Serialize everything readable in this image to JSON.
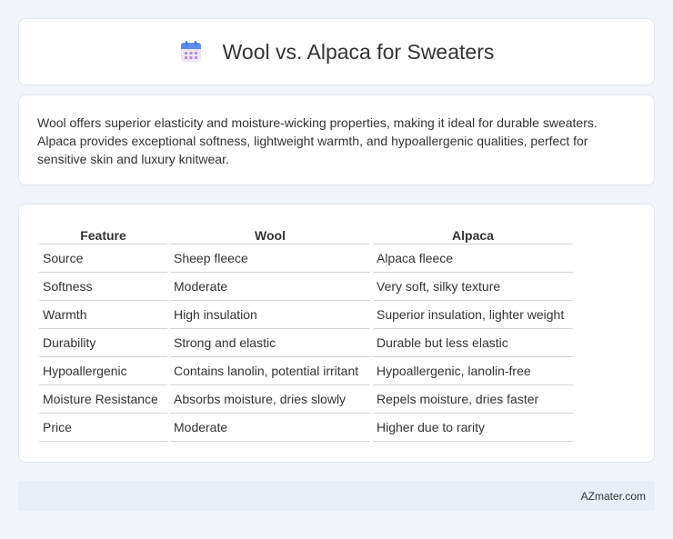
{
  "header": {
    "title": "Wool vs. Alpaca for Sweaters",
    "icon": "calendar-icon"
  },
  "description": "Wool offers superior elasticity and moisture-wicking properties, making it ideal for durable sweaters. Alpaca provides exceptional softness, lightweight warmth, and hypoallergenic qualities, perfect for sensitive skin and luxury knitwear.",
  "table": {
    "headers": [
      "Feature",
      "Wool",
      "Alpaca"
    ],
    "rows": [
      [
        "Source",
        "Sheep fleece",
        "Alpaca fleece"
      ],
      [
        "Softness",
        "Moderate",
        "Very soft, silky texture"
      ],
      [
        "Warmth",
        "High insulation",
        "Superior insulation, lighter weight"
      ],
      [
        "Durability",
        "Strong and elastic",
        "Durable but less elastic"
      ],
      [
        "Hypoallergenic",
        "Contains lanolin, potential irritant",
        "Hypoallergenic, lanolin-free"
      ],
      [
        "Moisture Resistance",
        "Absorbs moisture, dries slowly",
        "Repels moisture, dries faster"
      ],
      [
        "Price",
        "Moderate",
        "Higher due to rarity"
      ]
    ]
  },
  "footer": {
    "text": "AZmater.com"
  },
  "colors": {
    "background": "#f1f4f9",
    "card": "#ffffff",
    "footer_bg": "#e8edf6",
    "icon_top": "#5b8def",
    "icon_body": "#b9a3f0"
  }
}
